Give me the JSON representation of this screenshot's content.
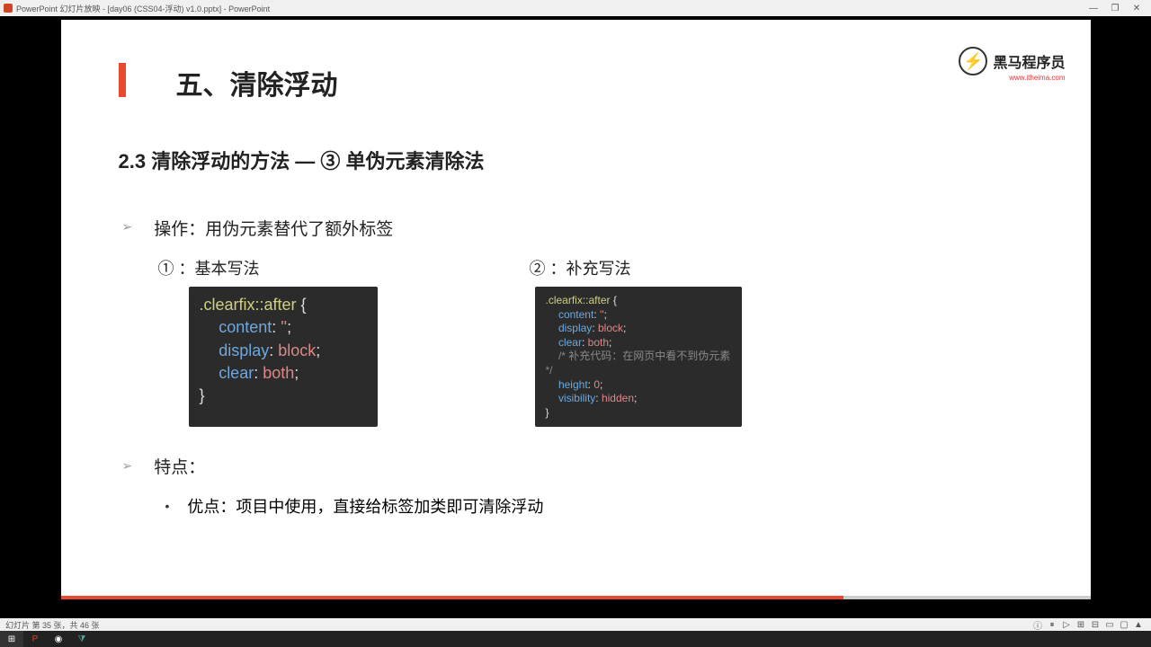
{
  "titlebar": {
    "text": "PowerPoint 幻灯片放映 - [day06 (CSS04-浮动) v1.0.pptx] - PowerPoint",
    "minimize": "—",
    "restore": "❐",
    "close": "✕"
  },
  "logo": {
    "glyph": "⚡",
    "name": "黑马程序员",
    "url": "www.itheima.com"
  },
  "slide": {
    "title": "五、清除浮动",
    "subtitle": "2.3 清除浮动的方法 — ③ 单伪元素清除法",
    "op_label": "操作：用伪元素替代了额外标签",
    "method1": "① ：基本写法",
    "method2": "② ：补充写法",
    "features_label": "特点：",
    "advantage": "优点：项目中使用，直接给标签加类即可清除浮动"
  },
  "code1": {
    "l1a": ".clearfix",
    "l1b": "::after",
    "l1c": " {",
    "l2a": "content",
    "l2b": ": ",
    "l2c": "''",
    "l2d": ";",
    "l3a": "display",
    "l3b": ": ",
    "l3c": "block",
    "l3d": ";",
    "l4a": "clear",
    "l4b": ": ",
    "l4c": "both",
    "l4d": ";",
    "l5": "}"
  },
  "code2": {
    "l1a": ".clearfix",
    "l1b": "::after",
    "l1c": " {",
    "l2a": "content",
    "l2b": ": ",
    "l2c": "''",
    "l2d": ";",
    "l3a": "display",
    "l3b": ": ",
    "l3c": "block",
    "l3d": ";",
    "l4a": "clear",
    "l4b": ": ",
    "l4c": "both",
    "l4d": ";",
    "l5": "/* 补充代码：在网页中看不到伪元素 */",
    "l6a": "height",
    "l6b": ": ",
    "l6c": "0",
    "l6d": ";",
    "l7a": "visibility",
    "l7b": ": ",
    "l7c": "hidden",
    "l7d": ";",
    "l8": "}"
  },
  "statusbar": {
    "text": "幻灯片 第 35 张，共 46 张"
  },
  "status_icons": {
    "i1": "ⓘ",
    "i2": "⏸",
    "i3": "▷",
    "i4": "⊞",
    "i5": "⊟",
    "i6": "▭",
    "i7": "▢",
    "i8": "▲"
  },
  "taskbar": {
    "win": "⊞",
    "pp": "P",
    "chrome": "◉",
    "vsc": "⧩"
  }
}
